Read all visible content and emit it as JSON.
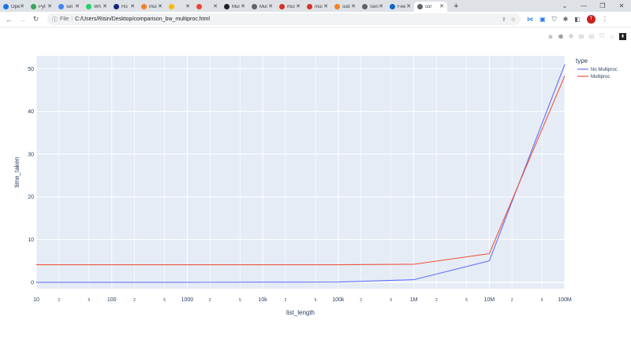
{
  "browser": {
    "tabs": [
      {
        "label": "Ope",
        "color": "#1a73e8"
      },
      {
        "label": "Pyt",
        "color": "#34a853"
      },
      {
        "label": "set",
        "color": "#4285f4"
      },
      {
        "label": "Wh",
        "color": "#25d366"
      },
      {
        "label": "Ho",
        "color": "#1a237e"
      },
      {
        "label": "mul",
        "color": "#f48024"
      },
      {
        "label": "",
        "color": "#fbbc04"
      },
      {
        "label": "",
        "color": "#ea4335"
      },
      {
        "label": "Mul",
        "color": "#202124"
      },
      {
        "label": "Mul",
        "color": "#5f6368"
      },
      {
        "label": "mul",
        "color": "#d93025"
      },
      {
        "label": "mul",
        "color": "#d93025"
      },
      {
        "label": "sub",
        "color": "#f48024"
      },
      {
        "label": "Sen",
        "color": "#5f6368"
      },
      {
        "label": "Fee",
        "color": "#0a66c2"
      },
      {
        "label": "cor",
        "color": "#5f6368",
        "active": true
      }
    ],
    "new_tab": "+",
    "address": {
      "scheme": "File",
      "path": "C:/Users/Risin/Desktop/comparison_bw_multiproc.html"
    },
    "profile_initial": "T"
  },
  "chart_data": {
    "type": "line",
    "xlabel": "list_length",
    "ylabel": "time_taken",
    "x_scale": "log",
    "xlim": [
      10,
      100000000
    ],
    "ylim": [
      -1.5,
      53
    ],
    "x": [
      10,
      100,
      1000,
      10000,
      100000,
      1000000,
      10000000,
      100000000
    ],
    "x_ticks": [
      {
        "value": 10,
        "label": "10"
      },
      {
        "value": 20,
        "label": "2"
      },
      {
        "value": 50,
        "label": "5"
      },
      {
        "value": 100,
        "label": "100"
      },
      {
        "value": 200,
        "label": "2"
      },
      {
        "value": 500,
        "label": "5"
      },
      {
        "value": 1000,
        "label": "1000"
      },
      {
        "value": 2000,
        "label": "2"
      },
      {
        "value": 5000,
        "label": "5"
      },
      {
        "value": 10000,
        "label": "10k"
      },
      {
        "value": 20000,
        "label": "2"
      },
      {
        "value": 50000,
        "label": "5"
      },
      {
        "value": 100000,
        "label": "100k"
      },
      {
        "value": 200000,
        "label": "2"
      },
      {
        "value": 500000,
        "label": "5"
      },
      {
        "value": 1000000,
        "label": "1M"
      },
      {
        "value": 2000000,
        "label": "2"
      },
      {
        "value": 5000000,
        "label": "5"
      },
      {
        "value": 10000000,
        "label": "10M"
      },
      {
        "value": 20000000,
        "label": "2"
      },
      {
        "value": 50000000,
        "label": "5"
      },
      {
        "value": 100000000,
        "label": "100M"
      }
    ],
    "y_ticks": [
      0,
      10,
      20,
      30,
      40,
      50
    ],
    "legend_title": "type",
    "legend_position": "top-right outside",
    "grid": true,
    "plot_background": "#e5ecf6",
    "series": [
      {
        "name": "No Multiproc",
        "color": "#636efa",
        "values": [
          0.0,
          0.0,
          0.0,
          0.02,
          0.05,
          0.6,
          5.0,
          51.0
        ]
      },
      {
        "name": "Multiproc",
        "color": "#ef553b",
        "values": [
          4.1,
          4.1,
          4.1,
          4.1,
          4.1,
          4.2,
          6.7,
          48.3
        ]
      }
    ]
  }
}
